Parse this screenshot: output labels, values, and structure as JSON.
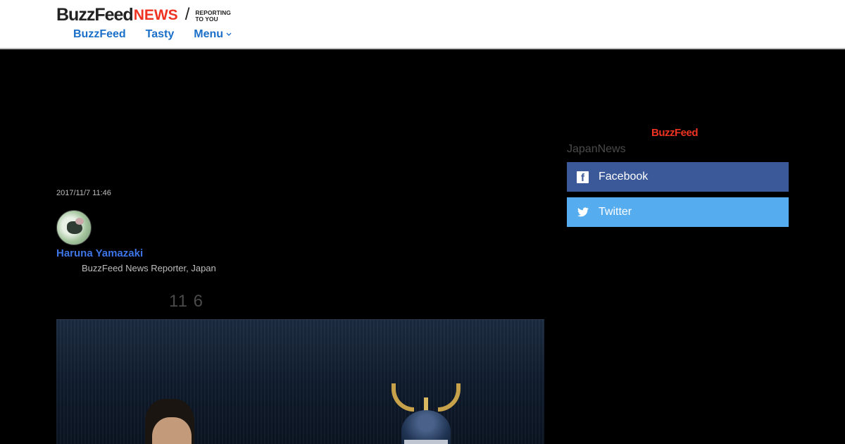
{
  "header": {
    "logo_buzzfeed": "BuzzFeed",
    "logo_news": "NEWS",
    "logo_slash": "/",
    "tagline_line1": "REPORTING",
    "tagline_line2": "TO YOU",
    "nav": [
      {
        "label": "BuzzFeed"
      },
      {
        "label": "Tasty"
      },
      {
        "label": "Menu"
      }
    ]
  },
  "article": {
    "timestamp": "2017/11/7 11:46",
    "author_name": "Haruna Yamazaki",
    "author_title": "BuzzFeed News Reporter, Japan",
    "share_count": "11 6"
  },
  "sidebar": {
    "logo": "BuzzFeed",
    "label": "JapanNews",
    "facebook_label": "Facebook",
    "twitter_label": "Twitter"
  },
  "colors": {
    "facebook": "#3b5898",
    "twitter": "#55acee",
    "nav_link": "#1a6fc9",
    "author_link": "#3d74e6",
    "brand_red": "#e32"
  }
}
